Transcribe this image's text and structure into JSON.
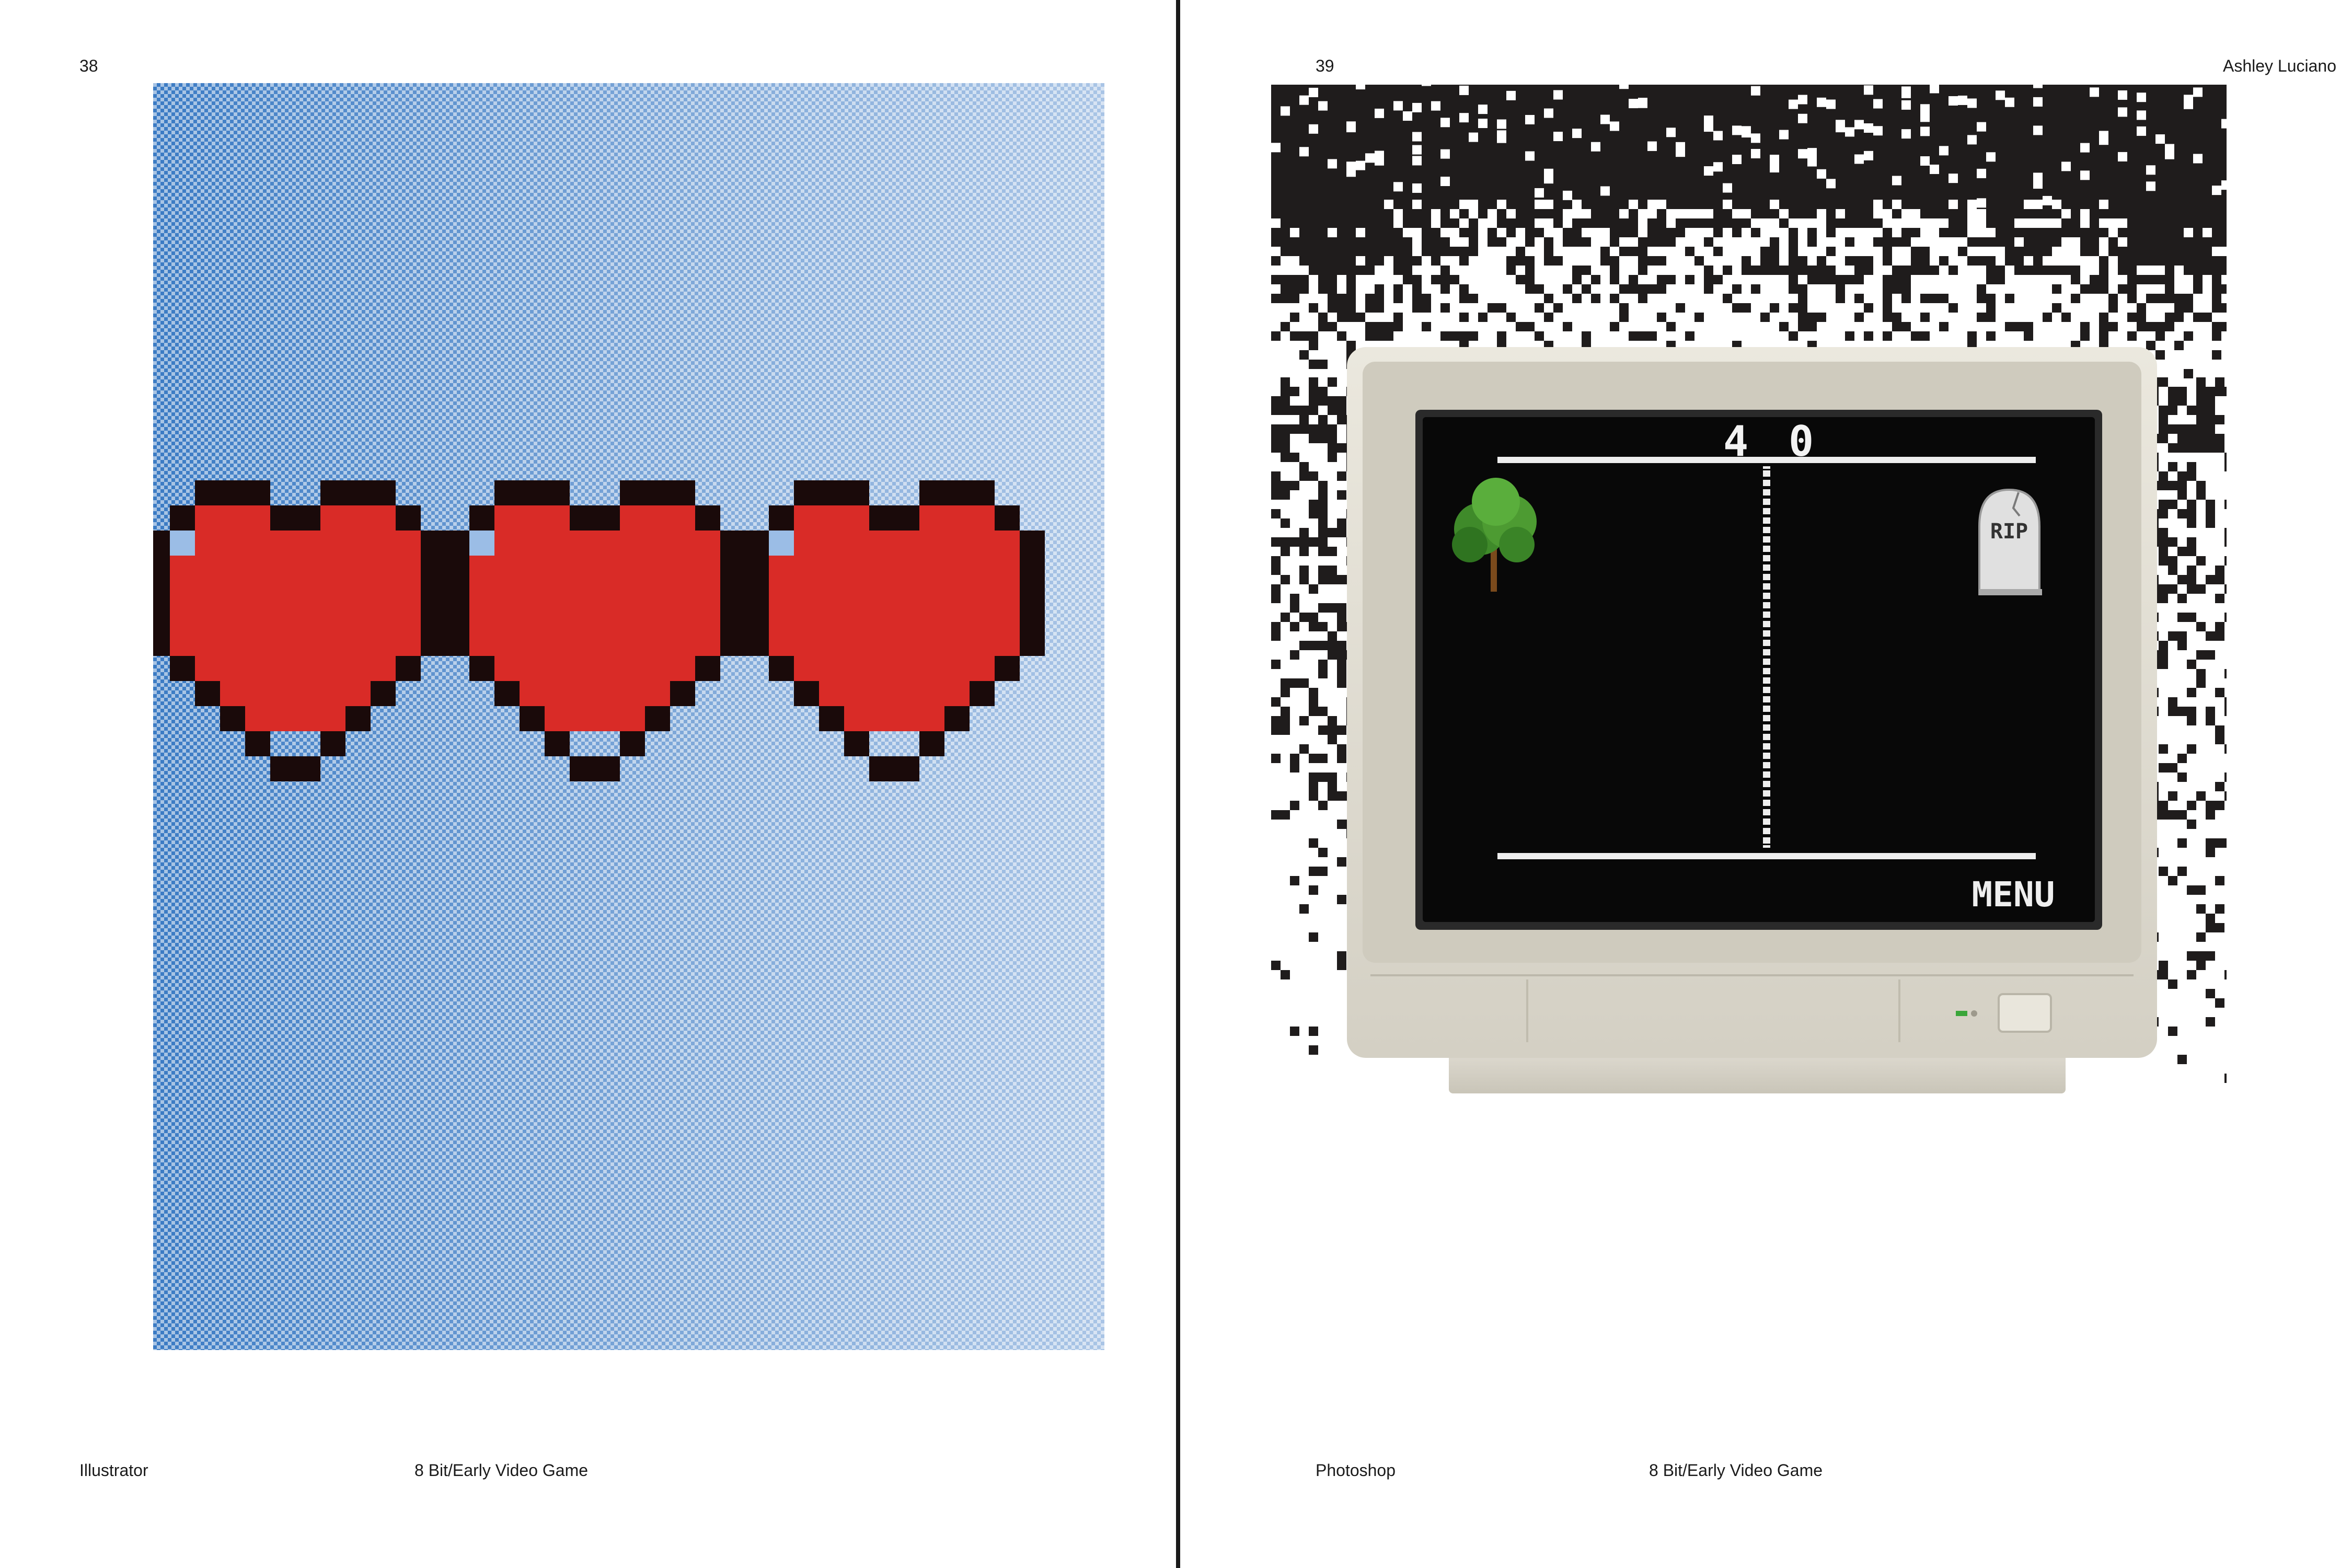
{
  "spread": {
    "left_page": {
      "page_number": "38",
      "footer": {
        "software": "Illustrator",
        "topic": "8 Bit/Early Video Game"
      },
      "artwork": {
        "icon": "pixel-heart-icon",
        "heart_count": 3,
        "background_color": "#3f7fc8",
        "heart_color": "#d92b27",
        "outline_color": "#1a0a0a"
      }
    },
    "right_page": {
      "page_number": "39",
      "author": "Ashley Luciano",
      "footer": {
        "software": "Photoshop",
        "topic": "8 Bit/Early Video Game"
      },
      "artwork": {
        "score_left": "4",
        "score_right": "0",
        "tombstone_text": "RIP",
        "menu_text": "MENU",
        "icons": [
          "tree-icon",
          "tombstone-icon"
        ],
        "monitor_color": "#e4e1d6",
        "screen_color": "#080808"
      }
    }
  }
}
